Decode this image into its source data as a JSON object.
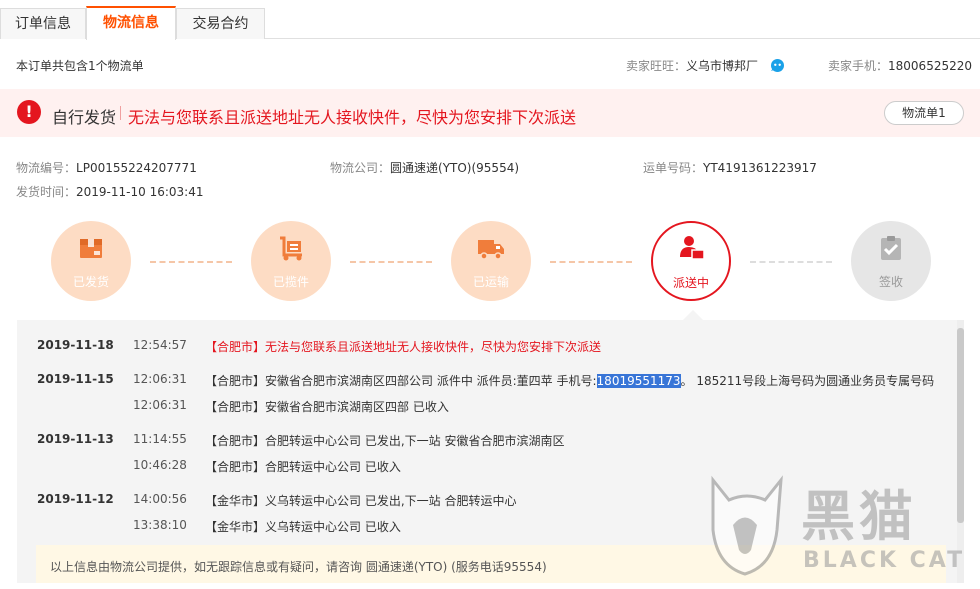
{
  "tabs": [
    {
      "label": "订单信息",
      "active": false
    },
    {
      "label": "物流信息",
      "active": true
    },
    {
      "label": "交易合约",
      "active": false
    }
  ],
  "summary": "本订单共包含1个物流单",
  "seller": {
    "wangwang_label": "卖家旺旺：",
    "wangwang_value": "义乌市博邦厂",
    "phone_label": "卖家手机：",
    "phone_value": "18006525220"
  },
  "alert": {
    "title": "自行发货",
    "message": "无法与您联系且派送地址无人接收快件，尽快为您安排下次派送",
    "button": "物流单1"
  },
  "details": {
    "logistics_no_label": "物流编号：",
    "logistics_no": "LP00155224207771",
    "company_label": "物流公司：",
    "company": "圆通速递(YTO)(95554)",
    "waybill_label": "运单号码：",
    "waybill": "YT4191361223917",
    "ship_time_label": "发货时间：",
    "ship_time": "2019-11-10 16:03:41"
  },
  "steps": [
    {
      "label": "已发货",
      "state": "done",
      "icon": "package-icon"
    },
    {
      "label": "已揽件",
      "state": "done",
      "icon": "cart-icon"
    },
    {
      "label": "已运输",
      "state": "done",
      "icon": "truck-icon"
    },
    {
      "label": "派送中",
      "state": "current",
      "icon": "courier-icon"
    },
    {
      "label": "签收",
      "state": "todo",
      "icon": "clipboard-check-icon"
    }
  ],
  "tracking": [
    {
      "date": "2019-11-18",
      "time": "12:54:57",
      "text": "【合肥市】无法与您联系且派送地址无人接收快件，尽快为您安排下次派送",
      "highlight": true
    },
    {
      "date": "2019-11-15",
      "time": "12:06:31",
      "text_before": "【合肥市】安徽省合肥市滨湖南区四部公司 派件中 派件员:董四苹 手机号:",
      "phone": "18019551173",
      "text_after": "。 185211号段上海号码为圆通业务员专属号码"
    },
    {
      "date": "",
      "time": "12:06:31",
      "text": "【合肥市】安徽省合肥市滨湖南区四部 已收入"
    },
    {
      "date": "2019-11-13",
      "time": "11:14:55",
      "text": "【合肥市】合肥转运中心公司 已发出,下一站 安徽省合肥市滨湖南区"
    },
    {
      "date": "",
      "time": "10:46:28",
      "text": "【合肥市】合肥转运中心公司 已收入"
    },
    {
      "date": "2019-11-12",
      "time": "14:00:56",
      "text": "【金华市】义乌转运中心公司 已发出,下一站 合肥转运中心"
    },
    {
      "date": "",
      "time": "13:38:10",
      "text": "【金华市】义乌转运中心公司 已收入"
    }
  ],
  "notice": "以上信息由物流公司提供，如无跟踪信息或有疑问，请咨询 圆通速递(YTO) (服务电话95554)",
  "watermark": {
    "cn": "黑猫",
    "en": "BLACK CAT"
  },
  "colors": {
    "accent": "#ff5000",
    "red": "#e4161f",
    "step_done": "#fddcc4",
    "step_todo": "#e6e6e6"
  }
}
